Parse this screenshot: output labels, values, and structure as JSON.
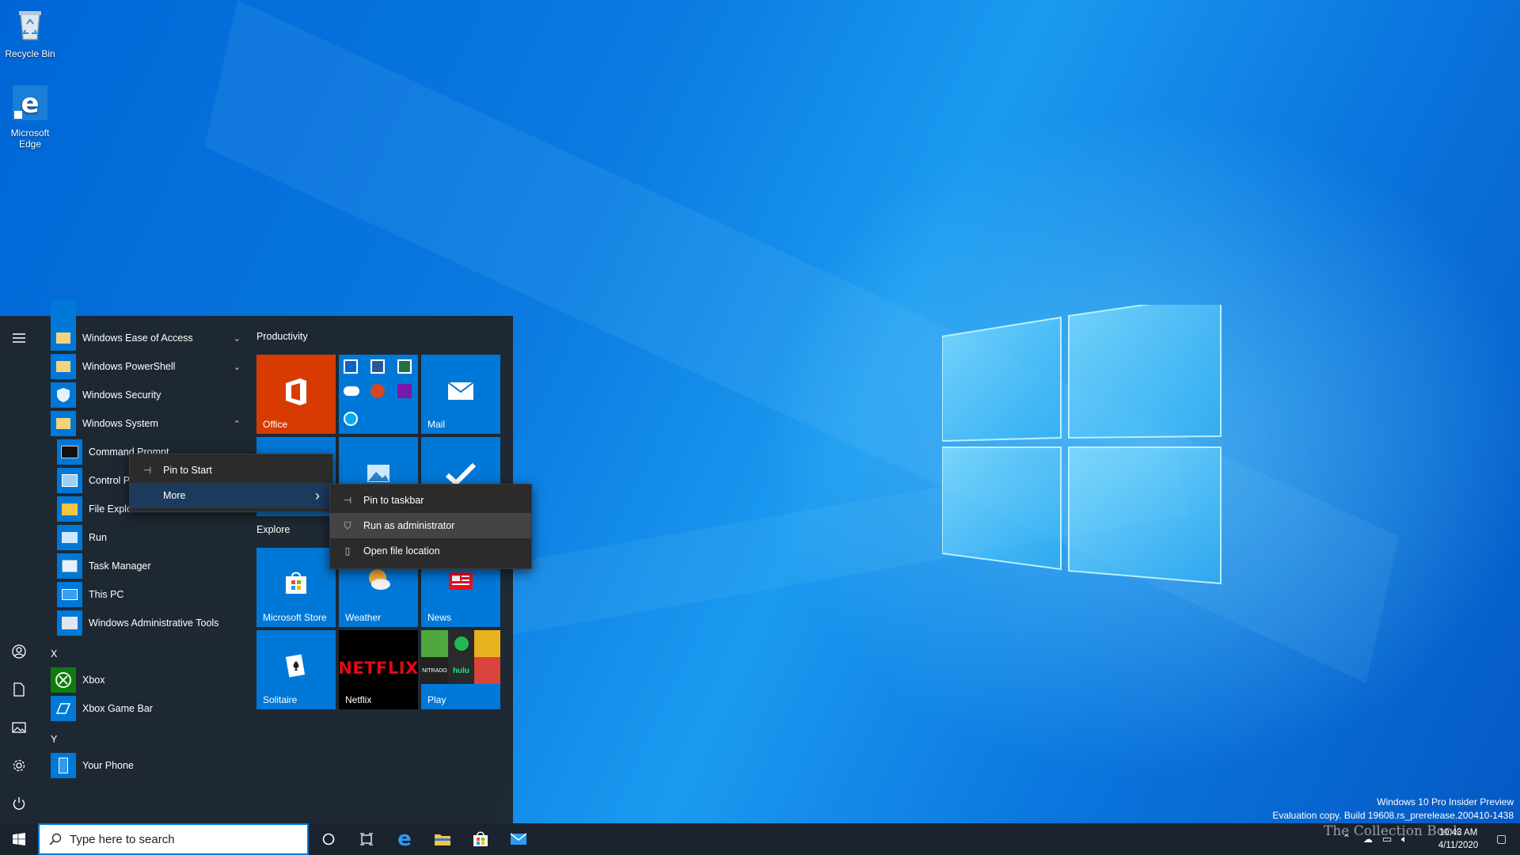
{
  "desktop": {
    "icons": [
      {
        "label": "Recycle Bin",
        "icon": "recycle-bin-icon"
      },
      {
        "label": "Microsoft Edge",
        "icon": "edge-icon"
      }
    ]
  },
  "start_menu": {
    "app_list": {
      "items": [
        {
          "label": "Windows Ease of Access",
          "icon": "folder-icon",
          "chevron": "⌄"
        },
        {
          "label": "Windows PowerShell",
          "icon": "folder-icon",
          "chevron": "⌄"
        },
        {
          "label": "Windows Security",
          "icon": "shield-icon",
          "chevron": ""
        },
        {
          "label": "Windows System",
          "icon": "folder-icon",
          "chevron": "⌃"
        },
        {
          "label": "Command Prompt",
          "icon": "cmd-icon"
        },
        {
          "label": "Control Pa",
          "icon": "control-panel-icon"
        },
        {
          "label": "File Explo",
          "icon": "file-explorer-icon"
        },
        {
          "label": "Run",
          "icon": "run-icon"
        },
        {
          "label": "Task Manager",
          "icon": "task-manager-icon"
        },
        {
          "label": "This PC",
          "icon": "this-pc-icon"
        },
        {
          "label": "Windows Administrative Tools",
          "icon": "admin-tools-icon"
        }
      ],
      "letter_x": "X",
      "x_items": [
        {
          "label": "Xbox",
          "icon": "xbox-icon"
        },
        {
          "label": "Xbox Game Bar",
          "icon": "xbox-game-bar-icon"
        }
      ],
      "letter_y": "Y",
      "y_items": [
        {
          "label": "Your Phone",
          "icon": "phone-icon"
        }
      ]
    },
    "tiles": {
      "productivity_title": "Productivity",
      "explore_title": "Explore",
      "office": "Office",
      "mail": "Mail",
      "microsoft_store": "Microsoft Store",
      "weather": "Weather",
      "news": "News",
      "solitaire": "Solitaire",
      "netflix": "Netflix",
      "netflix_logo": "NETFLIX",
      "play": "Play",
      "play_sub_nitrado": "NITRADO",
      "play_sub_hulu": "hulu"
    }
  },
  "context_menu": {
    "items": [
      {
        "label": "Pin to Start",
        "icon": "pin-icon"
      },
      {
        "label": "More",
        "icon": "",
        "arrow": "›"
      }
    ]
  },
  "submenu": {
    "items": [
      {
        "label": "Pin to taskbar",
        "icon": "pin-icon"
      },
      {
        "label": "Run as administrator",
        "icon": "shield-run-icon"
      },
      {
        "label": "Open file location",
        "icon": "file-location-icon"
      }
    ]
  },
  "taskbar": {
    "search_placeholder": "Type here to search",
    "time": "10:43 AM",
    "date": "4/11/2020"
  },
  "watermark": {
    "line1": "Windows 10 Pro Insider Preview",
    "line2": "Evaluation copy. Build 19608.rs_prerelease.200410-1438",
    "overlay": "The Collection Book"
  },
  "colors": {
    "office_tile": "#d83b01",
    "tile_blue": "#0078d7",
    "netflix_tile": "#000000",
    "menu_bg": "#1f252c",
    "accent": "#0078d7"
  }
}
